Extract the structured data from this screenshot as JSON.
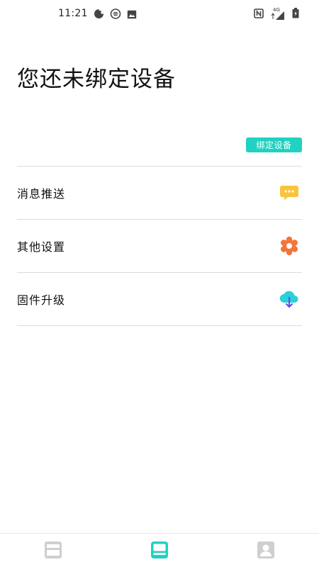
{
  "status_bar": {
    "time": "11:21",
    "network_type": "4G",
    "left_icons": [
      "data-saver-icon",
      "screen-record-icon",
      "image-icon"
    ],
    "right_icons": [
      "nfc-icon",
      "signal-icon",
      "battery-charging-icon"
    ]
  },
  "page": {
    "title": "您还未绑定设备",
    "bind_button_label": "绑定设备"
  },
  "menu": {
    "items": [
      {
        "label": "消息推送",
        "icon": "message-icon",
        "color": "#f9c33c"
      },
      {
        "label": "其他设置",
        "icon": "gear-icon",
        "color": "#f2753a"
      },
      {
        "label": "固件升级",
        "icon": "cloud-download-icon",
        "color": "#2ad0dc"
      }
    ]
  },
  "bottom_nav": {
    "tabs": [
      {
        "icon": "dashboard-icon",
        "active": false
      },
      {
        "icon": "device-icon",
        "active": true
      },
      {
        "icon": "profile-icon",
        "active": false
      }
    ],
    "active_color": "#1fd2c2",
    "inactive_color": "#cfcfcf"
  }
}
